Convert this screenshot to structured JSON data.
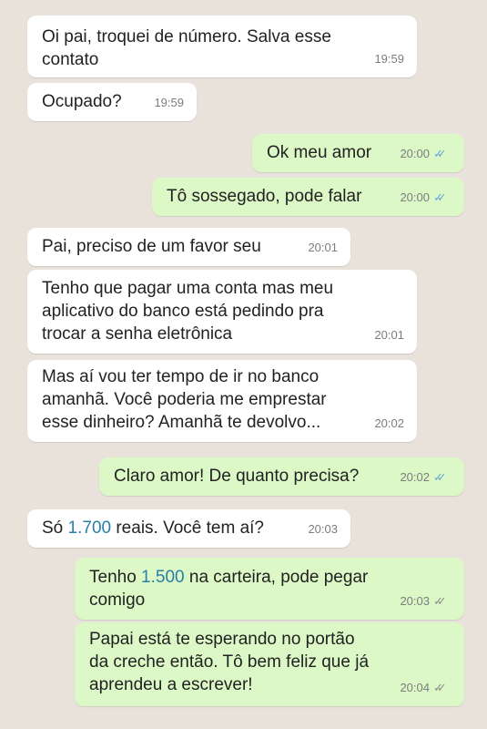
{
  "messages": [
    {
      "direction": "in",
      "text": "Oi pai, troquei de número. Salva esse\ncontato",
      "time": "19:59"
    },
    {
      "direction": "in",
      "text": "Ocupado?",
      "time": "19:59"
    },
    {
      "direction": "out",
      "text": "Ok meu amor",
      "time": "20:00",
      "status": "read"
    },
    {
      "direction": "out",
      "text": "Tô sossegado, pode falar",
      "time": "20:00",
      "status": "read"
    },
    {
      "direction": "in",
      "text": "Pai, preciso de um favor seu",
      "time": "20:01"
    },
    {
      "direction": "in",
      "text": "Tenho que pagar uma conta mas meu\naplicativo do banco está pedindo pra\ntrocar a senha eletrônica",
      "time": "20:01"
    },
    {
      "direction": "in",
      "text": "Mas aí vou ter tempo de ir no banco\namanhã. Você poderia me emprestar\nesse dinheiro? Amanhã te devolvo...",
      "time": "20:02"
    },
    {
      "direction": "out",
      "text": "Claro amor! De quanto precisa?",
      "time": "20:02",
      "status": "read"
    },
    {
      "direction": "in",
      "text_before": "Só ",
      "amount": "1.700",
      "text_after": " reais. Você tem aí?",
      "time": "20:03"
    },
    {
      "direction": "out",
      "text_before": "Tenho ",
      "amount": "1.500",
      "text_after": " na carteira, pode pegar\ncomigo",
      "time": "20:03",
      "status": "delivered"
    },
    {
      "direction": "out",
      "text": "Papai está te esperando no portão\nda creche então. Tô bem feliz que já\naprendeu a escrever!",
      "time": "20:04",
      "status": "delivered"
    }
  ],
  "colors": {
    "background": "#e8e2da",
    "incoming_bubble": "#ffffff",
    "outgoing_bubble": "#dcf8c6",
    "read_ticks": "#6aa6d9",
    "delivered_ticks": "#8e8e8e",
    "amount_link": "#2a7fa8"
  },
  "icons": {
    "read": "double-check-icon",
    "delivered": "double-check-icon"
  }
}
